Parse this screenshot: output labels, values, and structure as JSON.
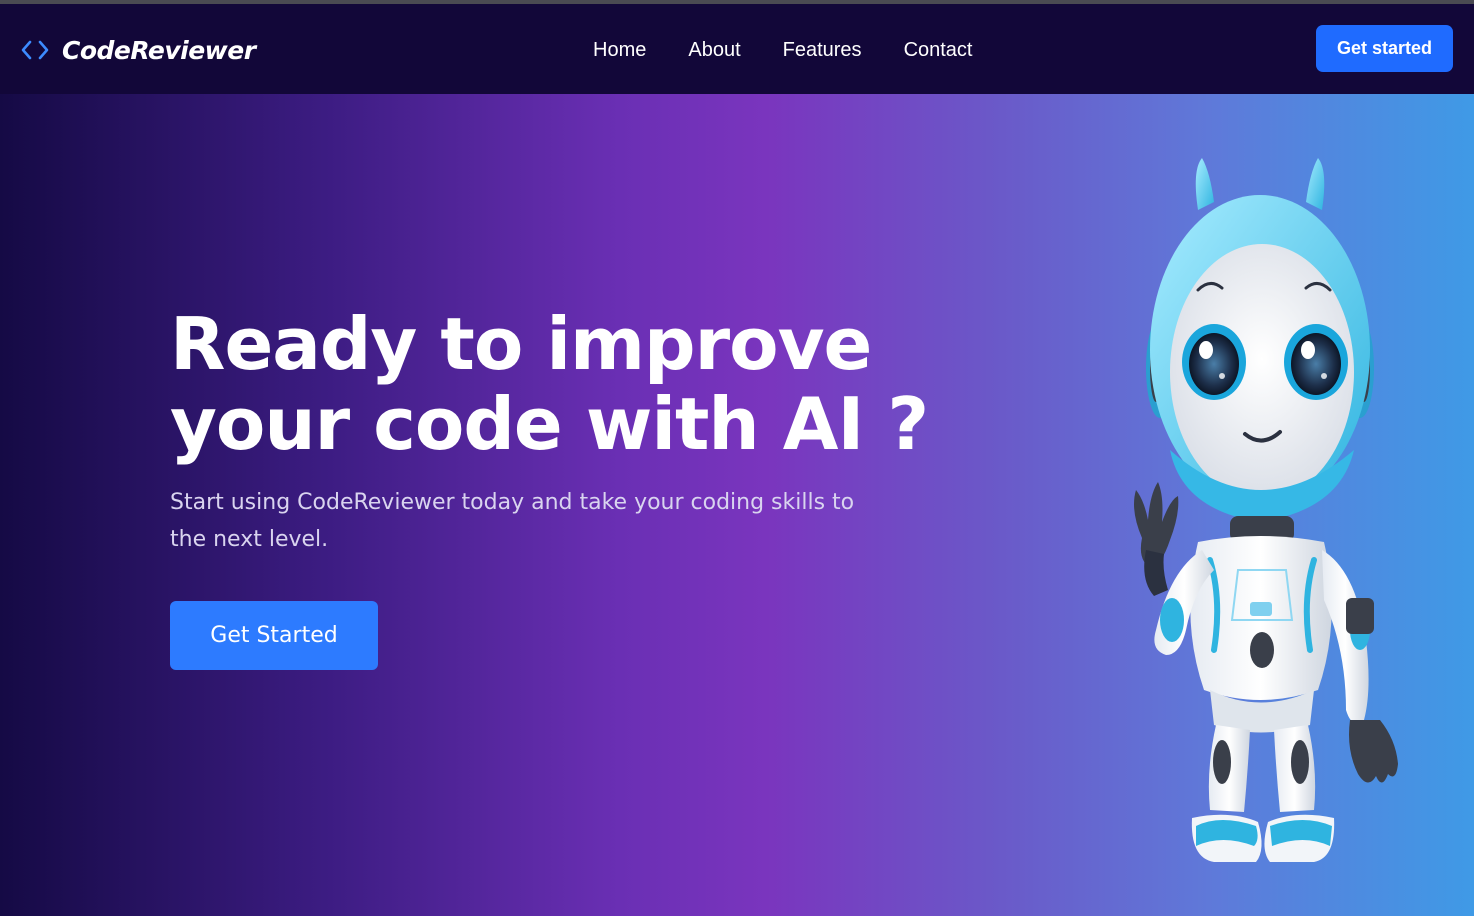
{
  "brand": {
    "name": "CodeReviewer",
    "icon": "code-brackets-icon",
    "icon_color": "#3d8bff"
  },
  "nav": {
    "items": [
      {
        "label": "Home"
      },
      {
        "label": "About"
      },
      {
        "label": "Features"
      },
      {
        "label": "Contact"
      }
    ],
    "cta_label": "Get started"
  },
  "hero": {
    "title_line1": "Ready to improve",
    "title_line2": "your code with AI ?",
    "subtitle": "Start using CodeReviewer today and take your coding skills to the next level.",
    "cta_label": "Get Started",
    "image": "robot-mascot-illustration"
  },
  "colors": {
    "navbar_bg": "#120739",
    "accent_blue": "#1f6bff",
    "gradient_start": "#150a45",
    "gradient_mid": "#7a35be",
    "gradient_end": "#3f9ae6"
  }
}
